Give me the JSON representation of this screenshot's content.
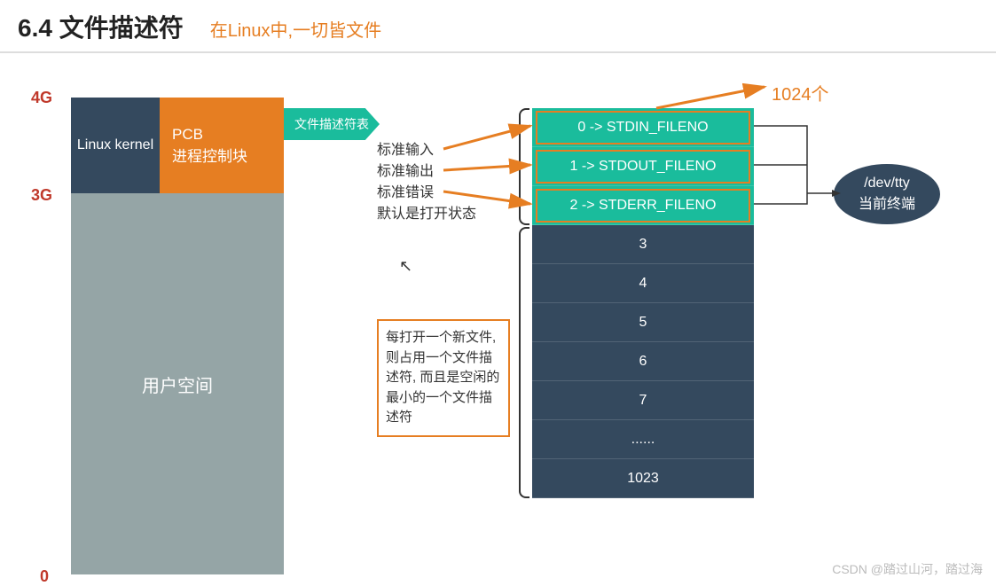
{
  "header": {
    "section": "6.4 文件描述符",
    "subtitle": "在Linux中,一切皆文件"
  },
  "axis": {
    "top": "4G",
    "mid": "3G",
    "bottom": "0"
  },
  "memory": {
    "kernel_label": "Linux kernel",
    "pcb_title": "PCB",
    "pcb_sub": "进程控制块",
    "user_space": "用户空间"
  },
  "arrow_label": "文件描述符表",
  "std": {
    "in": "标准输入",
    "out": "标准输出",
    "err": "标准错误",
    "default": "默认是打开状态"
  },
  "fd": {
    "r0": "0 -> STDIN_FILENO",
    "r1": "1 -> STDOUT_FILENO",
    "r2": "2 -> STDERR_FILENO",
    "r3": "3",
    "r4": "4",
    "r5": "5",
    "r6": "6",
    "r7": "7",
    "dots": "......",
    "last": "1023"
  },
  "count": "1024个",
  "note": "每打开一个新文件, 则占用一个文件描述符, 而且是空闲的最小的一个文件描述符",
  "devtty": {
    "l1": "/dev/tty",
    "l2": "当前终端"
  },
  "watermark": "CSDN @踏过山河，踏过海"
}
